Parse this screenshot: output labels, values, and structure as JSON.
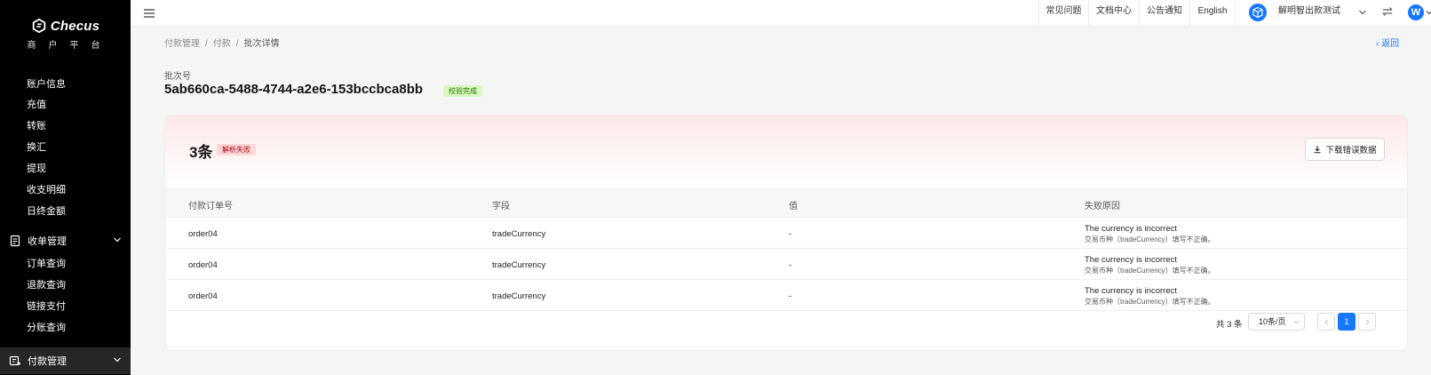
{
  "sidebar": {
    "brand": "Checus",
    "subtitle": "商户平台",
    "items_top": [
      "账户信息",
      "充值",
      "转账",
      "换汇",
      "提现",
      "收支明细",
      "日终金额"
    ],
    "group_collect": {
      "label": "收单管理"
    },
    "items_collect": [
      "订单查询",
      "退款查询",
      "链接支付",
      "分账查询"
    ],
    "group_payout": {
      "label": "付款管理"
    }
  },
  "header": {
    "links": [
      "常见问题",
      "文档中心",
      "公告通知",
      "English"
    ],
    "account_name": "解明智出款测试",
    "avatar_letter": "W"
  },
  "breadcrumb": [
    "付款管理",
    "付款",
    "批次详情"
  ],
  "back_label": "返回",
  "batch": {
    "label": "批次号",
    "id": "5ab660ca-5488-4744-a2e6-153bccbca8bb",
    "status": "校验完成"
  },
  "result": {
    "count": "3条",
    "status": "解析失败",
    "download_label": "下载错误数据"
  },
  "table": {
    "columns": [
      "付款订单号",
      "字段",
      "值",
      "失败原因"
    ],
    "rows": [
      {
        "order": "order04",
        "field": "tradeCurrency",
        "value": "-",
        "reason": "The currency is incorrect",
        "reason_sub": "交易币种（tradeCurrency）填写不正确。"
      },
      {
        "order": "order04",
        "field": "tradeCurrency",
        "value": "-",
        "reason": "The currency is incorrect",
        "reason_sub": "交易币种（tradeCurrency）填写不正确。"
      },
      {
        "order": "order04",
        "field": "tradeCurrency",
        "value": "-",
        "reason": "The currency is incorrect",
        "reason_sub": "交易币种（tradeCurrency）填写不正确。"
      }
    ]
  },
  "pagination": {
    "total": "共 3 条",
    "page_size": "10条/页",
    "current_page": "1"
  },
  "colors": {
    "primary": "#1677ff",
    "sidebar_bg": "#000000",
    "success_tag": "#d9f7be",
    "error_tag": "#ffd6d6"
  }
}
